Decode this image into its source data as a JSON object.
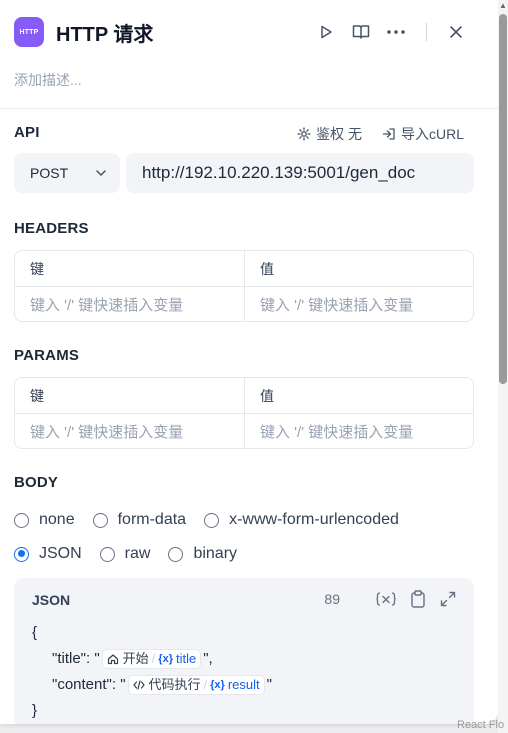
{
  "header": {
    "app_icon_text": "HTTP",
    "title": "HTTP 请求",
    "icons": [
      "play-icon",
      "book-open-icon",
      "more-icon",
      "close-icon"
    ]
  },
  "description_placeholder": "添加描述...",
  "api": {
    "label": "API",
    "auth_label": "鉴权 无",
    "import_label": "导入cURL",
    "method": "POST",
    "url": "http://192.10.220.139:5001/gen_doc"
  },
  "headers": {
    "label": "HEADERS",
    "columns": [
      "键",
      "值"
    ],
    "key_placeholder": "键入 '/' 键快速插入变量",
    "value_placeholder": "键入 '/' 键快速插入变量"
  },
  "params": {
    "label": "PARAMS",
    "columns": [
      "键",
      "值"
    ],
    "key_placeholder": "键入 '/' 键快速插入变量",
    "value_placeholder": "键入 '/' 键快速插入变量"
  },
  "body": {
    "label": "BODY",
    "options_row1": [
      "none",
      "form-data",
      "x-www-form-urlencoded"
    ],
    "options_row2": [
      "JSON",
      "raw",
      "binary"
    ],
    "selected": "JSON"
  },
  "json_editor": {
    "label": "JSON",
    "char_count": "89",
    "line1": "{",
    "line2_key": "\"title\": \"",
    "line2_node": "开始",
    "line2_var": "title",
    "line2_end": "\",",
    "line3_key": "\"content\": \"",
    "line3_node": "代码执行",
    "line3_var": "result",
    "line3_end": "\"",
    "line4": "}"
  },
  "footer_hint": "React Flo",
  "colors": {
    "accent": "#1570ef",
    "app_icon": "#875bf7",
    "var_blue": "#155eef"
  }
}
